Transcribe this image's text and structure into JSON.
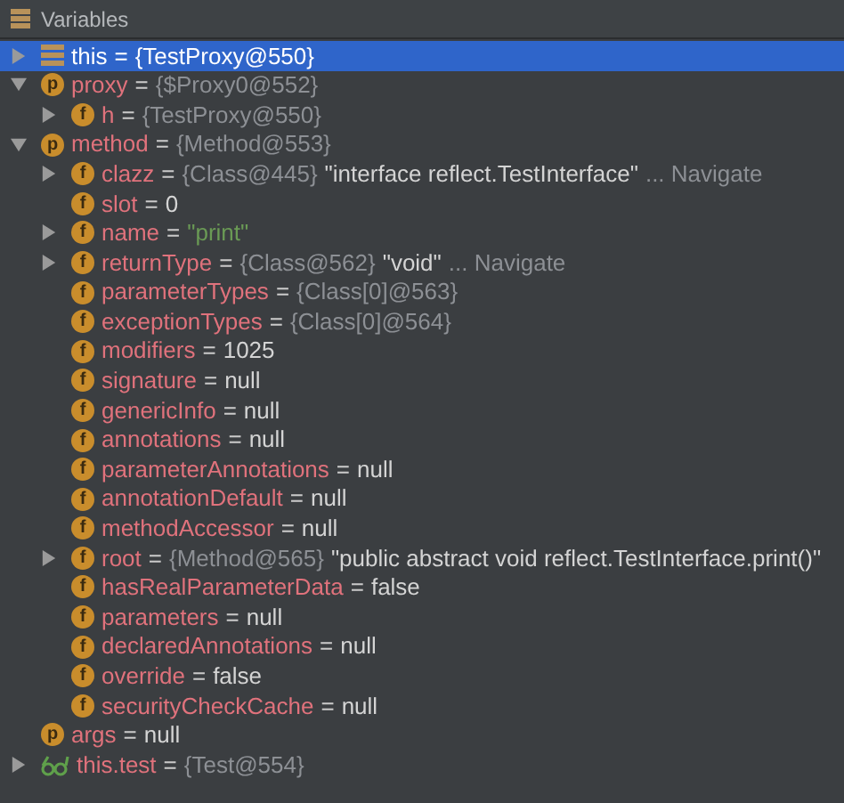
{
  "panel": {
    "title": "Variables"
  },
  "tree": [
    {
      "name": "this",
      "icon": {
        "kind": "stack"
      },
      "expanded": false,
      "selected": true,
      "parts": [
        {
          "kind": "op",
          "text": "="
        },
        {
          "kind": "text",
          "text": "{TestProxy@550}"
        }
      ]
    },
    {
      "name": "proxy",
      "icon": {
        "kind": "badge",
        "letter": "p"
      },
      "expanded": true,
      "selected": false,
      "parts": [
        {
          "kind": "op",
          "text": "="
        },
        {
          "kind": "ref",
          "text": "{$Proxy0@552}"
        }
      ],
      "children": [
        {
          "name": "h",
          "icon": {
            "kind": "badge",
            "letter": "f"
          },
          "expanded": false,
          "selected": false,
          "parts": [
            {
              "kind": "op",
              "text": "="
            },
            {
              "kind": "ref",
              "text": "{TestProxy@550}"
            }
          ]
        }
      ]
    },
    {
      "name": "method",
      "icon": {
        "kind": "badge",
        "letter": "p"
      },
      "expanded": true,
      "selected": false,
      "parts": [
        {
          "kind": "op",
          "text": "="
        },
        {
          "kind": "ref",
          "text": "{Method@553}"
        }
      ],
      "children": [
        {
          "name": "clazz",
          "icon": {
            "kind": "badge",
            "letter": "f"
          },
          "expanded": false,
          "selected": false,
          "parts": [
            {
              "kind": "op",
              "text": "="
            },
            {
              "kind": "ref",
              "text": "{Class@445}"
            },
            {
              "kind": "text",
              "text": "\"interface reflect.TestInterface\""
            },
            {
              "kind": "link",
              "text": "... Navigate"
            }
          ]
        },
        {
          "name": "slot",
          "icon": {
            "kind": "badge",
            "letter": "f"
          },
          "selected": false,
          "parts": [
            {
              "kind": "op",
              "text": "="
            },
            {
              "kind": "text",
              "text": "0"
            }
          ]
        },
        {
          "name": "name",
          "icon": {
            "kind": "badge",
            "letter": "f"
          },
          "expanded": false,
          "selected": false,
          "parts": [
            {
              "kind": "op",
              "text": "="
            },
            {
              "kind": "string",
              "text": "\"print\""
            }
          ]
        },
        {
          "name": "returnType",
          "icon": {
            "kind": "badge",
            "letter": "f"
          },
          "expanded": false,
          "selected": false,
          "parts": [
            {
              "kind": "op",
              "text": "="
            },
            {
              "kind": "ref",
              "text": "{Class@562}"
            },
            {
              "kind": "text",
              "text": "\"void\""
            },
            {
              "kind": "link",
              "text": "... Navigate"
            }
          ]
        },
        {
          "name": "parameterTypes",
          "icon": {
            "kind": "badge",
            "letter": "f"
          },
          "selected": false,
          "parts": [
            {
              "kind": "op",
              "text": "="
            },
            {
              "kind": "ref",
              "text": "{Class[0]@563}"
            }
          ]
        },
        {
          "name": "exceptionTypes",
          "icon": {
            "kind": "badge",
            "letter": "f"
          },
          "selected": false,
          "parts": [
            {
              "kind": "op",
              "text": "="
            },
            {
              "kind": "ref",
              "text": "{Class[0]@564}"
            }
          ]
        },
        {
          "name": "modifiers",
          "icon": {
            "kind": "badge",
            "letter": "f"
          },
          "selected": false,
          "parts": [
            {
              "kind": "op",
              "text": "="
            },
            {
              "kind": "text",
              "text": "1025"
            }
          ]
        },
        {
          "name": "signature",
          "icon": {
            "kind": "badge",
            "letter": "f"
          },
          "selected": false,
          "parts": [
            {
              "kind": "op",
              "text": "="
            },
            {
              "kind": "text",
              "text": "null"
            }
          ]
        },
        {
          "name": "genericInfo",
          "icon": {
            "kind": "badge",
            "letter": "f"
          },
          "selected": false,
          "parts": [
            {
              "kind": "op",
              "text": "="
            },
            {
              "kind": "text",
              "text": "null"
            }
          ]
        },
        {
          "name": "annotations",
          "icon": {
            "kind": "badge",
            "letter": "f"
          },
          "selected": false,
          "parts": [
            {
              "kind": "op",
              "text": "="
            },
            {
              "kind": "text",
              "text": "null"
            }
          ]
        },
        {
          "name": "parameterAnnotations",
          "icon": {
            "kind": "badge",
            "letter": "f"
          },
          "selected": false,
          "parts": [
            {
              "kind": "op",
              "text": "="
            },
            {
              "kind": "text",
              "text": "null"
            }
          ]
        },
        {
          "name": "annotationDefault",
          "icon": {
            "kind": "badge",
            "letter": "f"
          },
          "selected": false,
          "parts": [
            {
              "kind": "op",
              "text": "="
            },
            {
              "kind": "text",
              "text": "null"
            }
          ]
        },
        {
          "name": "methodAccessor",
          "icon": {
            "kind": "badge",
            "letter": "f"
          },
          "selected": false,
          "parts": [
            {
              "kind": "op",
              "text": "="
            },
            {
              "kind": "text",
              "text": "null"
            }
          ]
        },
        {
          "name": "root",
          "icon": {
            "kind": "badge",
            "letter": "f"
          },
          "expanded": false,
          "selected": false,
          "parts": [
            {
              "kind": "op",
              "text": "="
            },
            {
              "kind": "ref",
              "text": "{Method@565}"
            },
            {
              "kind": "text",
              "text": "\"public abstract void reflect.TestInterface.print()\""
            }
          ]
        },
        {
          "name": "hasRealParameterData",
          "icon": {
            "kind": "badge",
            "letter": "f"
          },
          "selected": false,
          "parts": [
            {
              "kind": "op",
              "text": "="
            },
            {
              "kind": "text",
              "text": "false"
            }
          ]
        },
        {
          "name": "parameters",
          "icon": {
            "kind": "badge",
            "letter": "f"
          },
          "selected": false,
          "parts": [
            {
              "kind": "op",
              "text": "="
            },
            {
              "kind": "text",
              "text": "null"
            }
          ]
        },
        {
          "name": "declaredAnnotations",
          "icon": {
            "kind": "badge",
            "letter": "f"
          },
          "selected": false,
          "parts": [
            {
              "kind": "op",
              "text": "="
            },
            {
              "kind": "text",
              "text": "null"
            }
          ]
        },
        {
          "name": "override",
          "icon": {
            "kind": "badge",
            "letter": "f"
          },
          "selected": false,
          "parts": [
            {
              "kind": "op",
              "text": "="
            },
            {
              "kind": "text",
              "text": "false"
            }
          ]
        },
        {
          "name": "securityCheckCache",
          "icon": {
            "kind": "badge",
            "letter": "f"
          },
          "selected": false,
          "parts": [
            {
              "kind": "op",
              "text": "="
            },
            {
              "kind": "text",
              "text": "null"
            }
          ]
        }
      ]
    },
    {
      "name": "args",
      "icon": {
        "kind": "badge",
        "letter": "p"
      },
      "selected": false,
      "parts": [
        {
          "kind": "op",
          "text": "="
        },
        {
          "kind": "text",
          "text": "null"
        }
      ]
    },
    {
      "name": "this.test",
      "icon": {
        "kind": "watch"
      },
      "expanded": false,
      "selected": false,
      "parts": [
        {
          "kind": "op",
          "text": "="
        },
        {
          "kind": "ref",
          "text": "{Test@554}"
        }
      ]
    }
  ]
}
